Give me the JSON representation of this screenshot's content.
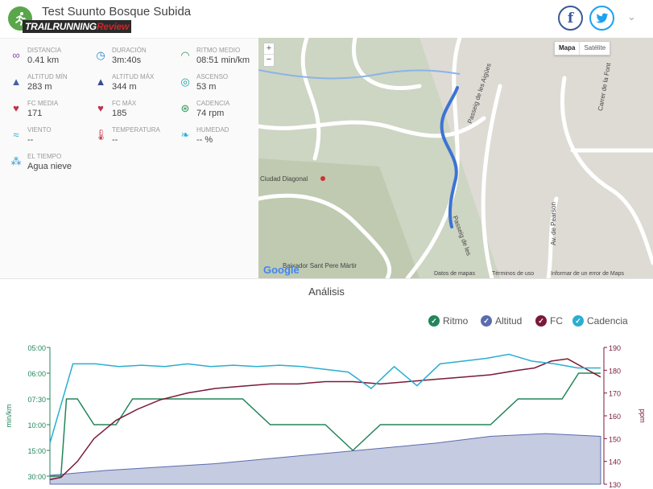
{
  "header": {
    "title": "Test Suunto Bosque Subida",
    "brand_main": "TRAILRUNNING",
    "brand_accent": "Review",
    "facebook_icon": "f",
    "twitter_icon": "🐦",
    "chevron": "⌄"
  },
  "stats": [
    {
      "name": "distancia",
      "label": "DISTANCIA",
      "value": "0.41 km",
      "icon": "route-icon",
      "glyph": "∞",
      "color": "#8c4ea3"
    },
    {
      "name": "duracion",
      "label": "DURACIÓN",
      "value": "3m:40s",
      "icon": "stopwatch-icon",
      "glyph": "◷",
      "color": "#2b86c8"
    },
    {
      "name": "ritmo-medio",
      "label": "RITMO MEDIO",
      "value": "08:51 min/km",
      "icon": "gauge-icon",
      "glyph": "◠",
      "color": "#2a9a5a"
    },
    {
      "name": "altitud-min",
      "label": "ALTITUD MÍN",
      "value": "283 m",
      "icon": "mountain-low-icon",
      "glyph": "▲",
      "color": "#4a5ea8"
    },
    {
      "name": "altitud-max",
      "label": "ALTITUD MÁX",
      "value": "344 m",
      "icon": "mountain-high-icon",
      "glyph": "▲",
      "color": "#3a4a98"
    },
    {
      "name": "ascenso",
      "label": "ASCENSO",
      "value": "53 m",
      "icon": "ascent-icon",
      "glyph": "◎",
      "color": "#1aa0a8"
    },
    {
      "name": "fc-media",
      "label": "FC MEDIA",
      "value": "171",
      "icon": "heart-icon",
      "glyph": "♥",
      "color": "#c0324a"
    },
    {
      "name": "fc-max",
      "label": "FC MÁX",
      "value": "185",
      "icon": "heart-max-icon",
      "glyph": "♥",
      "color": "#c0324a"
    },
    {
      "name": "cadencia",
      "label": "CADENCIA",
      "value": "74 rpm",
      "icon": "cadence-icon",
      "glyph": "⊛",
      "color": "#2a9a5a"
    },
    {
      "name": "viento",
      "label": "VIENTO",
      "value": "--",
      "icon": "wind-icon",
      "glyph": "≈",
      "color": "#2ab0d8"
    },
    {
      "name": "temperatura",
      "label": "TEMPERATURA",
      "value": "--",
      "icon": "thermometer-icon",
      "glyph": "🌡",
      "color": "#c0324a"
    },
    {
      "name": "humedad",
      "label": "HUMEDAD",
      "value": "-- %",
      "icon": "humidity-icon",
      "glyph": "❧",
      "color": "#2ab0d8"
    },
    {
      "name": "el-tiempo",
      "label": "EL TIEMPO",
      "value": "Agua nieve",
      "icon": "weather-icon",
      "glyph": "⁂",
      "color": "#2a9ad8"
    }
  ],
  "map": {
    "zoom_in": "+",
    "zoom_out": "−",
    "type_map": "Mapa",
    "type_satellite": "Satélite",
    "labels": {
      "ciudad_diagonal": "Ciudad Diagonal",
      "passeig_aigues": "Passeig de les Aigües",
      "passeig_aigues_2": "Passeig de les",
      "carrer_fon": "Carrer de la Font",
      "av_pearson": "Av. de Pearson",
      "sant_pere": "Baixador Sant Pere Màrtir"
    },
    "google": "Google",
    "footer": {
      "datos": "Datos de mapas",
      "terminos": "Términos de uso",
      "informar": "Informar de un error de Maps"
    }
  },
  "analysis": {
    "title": "Análisis",
    "legend": [
      {
        "name": "Ritmo",
        "color": "#23855a"
      },
      {
        "name": "Altitud",
        "color": "#5b6cae"
      },
      {
        "name": "FC",
        "color": "#7a1a38"
      },
      {
        "name": "Cadencia",
        "color": "#2aaed0"
      }
    ]
  },
  "chart_data": {
    "type": "line",
    "left_axis": {
      "label": "min/km",
      "ticks": [
        "05:00",
        "06:00",
        "07:30",
        "10:00",
        "15:00",
        "30:00"
      ],
      "color": "#23855a"
    },
    "right_axis": {
      "label": "ppm",
      "ticks": [
        130,
        140,
        150,
        160,
        170,
        180,
        190
      ],
      "color": "#7a1a38"
    },
    "series": [
      {
        "name": "Cadencia",
        "color": "#2aaed0",
        "axis": "cadence_pace_scale",
        "values": [
          30,
          88,
          88,
          86,
          87,
          86,
          88,
          86,
          87,
          86,
          87,
          86,
          84,
          82,
          70,
          86,
          72,
          88,
          90,
          92,
          95,
          90,
          88,
          85,
          85
        ],
        "note": "drawn on normalized 0-100 vertical scale"
      },
      {
        "name": "FC",
        "color": "#7a1a38",
        "axis": "ppm",
        "x": [
          0,
          2,
          5,
          8,
          12,
          16,
          20,
          25,
          30,
          35,
          40,
          45,
          50,
          55,
          60,
          65,
          70,
          75,
          80,
          85,
          88,
          91,
          94,
          97,
          100
        ],
        "values": [
          132,
          133,
          140,
          150,
          158,
          163,
          167,
          170,
          172,
          173,
          174,
          174,
          175,
          175,
          174,
          175,
          176,
          177,
          178,
          180,
          181,
          184,
          185,
          181,
          177
        ]
      },
      {
        "name": "Ritmo",
        "color": "#23855a",
        "axis": "min/km",
        "x": [
          0,
          2,
          3,
          5,
          8,
          12,
          15,
          20,
          25,
          30,
          35,
          40,
          45,
          50,
          55,
          60,
          65,
          70,
          75,
          80,
          85,
          90,
          93,
          96,
          100
        ],
        "values": [
          "30:00",
          "30:00",
          "07:30",
          "07:30",
          "10:00",
          "10:00",
          "07:30",
          "07:30",
          "07:30",
          "07:30",
          "07:30",
          "10:00",
          "10:00",
          "10:00",
          "15:00",
          "10:00",
          "10:00",
          "10:00",
          "10:00",
          "10:00",
          "07:30",
          "07:30",
          "07:30",
          "06:00",
          "06:00"
        ]
      },
      {
        "name": "Altitud",
        "color": "#5b6cae",
        "axis": "m",
        "x": [
          0,
          10,
          30,
          50,
          70,
          80,
          90,
          100
        ],
        "values": [
          283,
          290,
          300,
          315,
          330,
          340,
          344,
          340
        ]
      }
    ],
    "x_count": 100
  }
}
